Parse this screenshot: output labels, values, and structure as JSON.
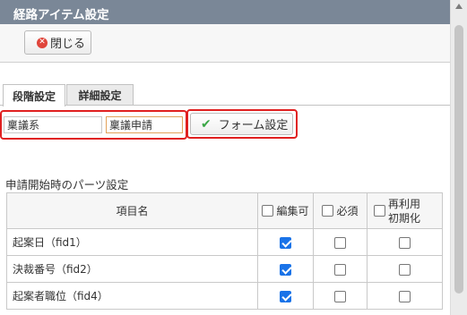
{
  "window": {
    "title": "経路アイテム設定"
  },
  "toolbar": {
    "close_label": "閉じる"
  },
  "tabs": [
    {
      "label": "段階設定",
      "active": true
    },
    {
      "label": "詳細設定",
      "active": false
    }
  ],
  "form": {
    "field1_value": "稟議系",
    "field2_value": "稟議申請",
    "form_settings_label": "フォーム設定"
  },
  "parts_section": {
    "title": "申請開始時のパーツ設定",
    "headers": {
      "item_name": "項目名",
      "editable": "編集可",
      "required": "必須",
      "reuse_line1": "再利用",
      "reuse_line2": "初期化"
    },
    "rows": [
      {
        "name": "起案日（fid1）",
        "editable": true,
        "required": false,
        "reuse": false
      },
      {
        "name": "決裁番号（fid2）",
        "editable": true,
        "required": false,
        "reuse": false
      },
      {
        "name": "起案者職位（fid4）",
        "editable": true,
        "required": false,
        "reuse": false
      }
    ]
  },
  "colors": {
    "titlebar": "#7a8797",
    "highlight": "#e02020",
    "checkbox_checked": "#1a73e8",
    "check_icon": "#3aa645"
  }
}
